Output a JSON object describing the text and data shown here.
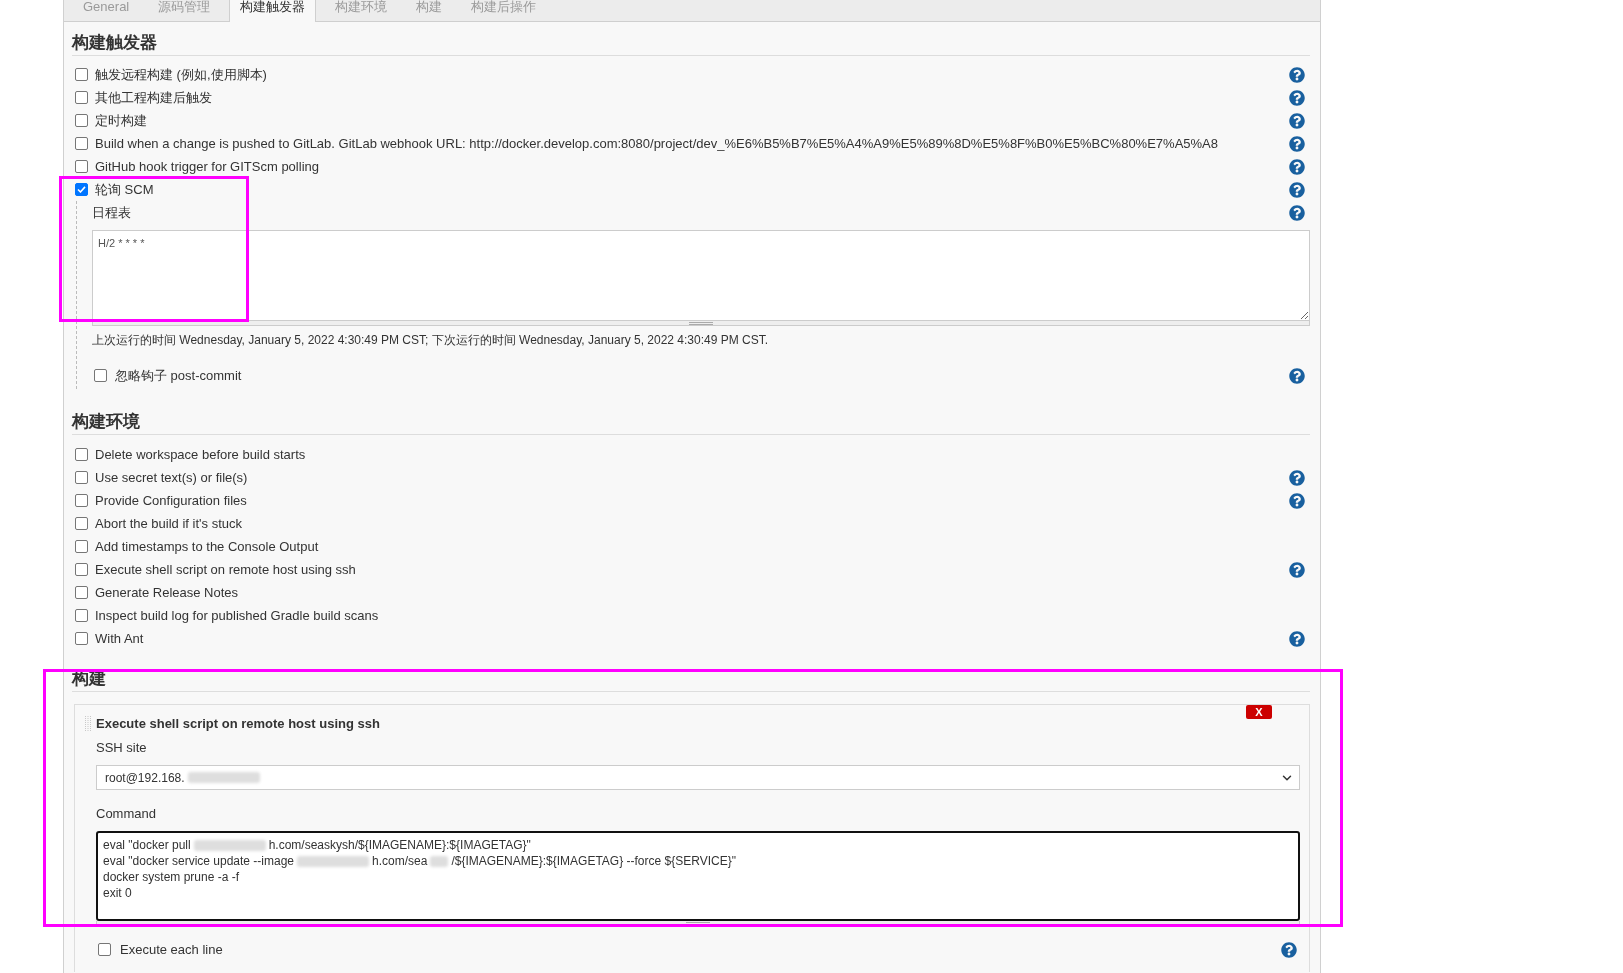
{
  "tabs": [
    {
      "label": "General",
      "selected": false
    },
    {
      "label": "源码管理",
      "selected": false
    },
    {
      "label": "构建触发器",
      "selected": true
    },
    {
      "label": "构建环境",
      "selected": false
    },
    {
      "label": "构建",
      "selected": false
    },
    {
      "label": "构建后操作",
      "selected": false
    }
  ],
  "sections": [
    {
      "kind": "triggers",
      "title": "构建触发器",
      "highlighted": false,
      "items": [
        {
          "label": "触发远程构建 (例如,使用脚本)",
          "checked": false,
          "help": true,
          "highlighted": false
        },
        {
          "label": "其他工程构建后触发",
          "checked": false,
          "help": true,
          "highlighted": false
        },
        {
          "label": "定时构建",
          "checked": false,
          "help": true,
          "highlighted": false
        },
        {
          "label": "Build when a change is pushed to GitLab. GitLab webhook URL: http://docker.develop.com:8080/project/dev_%E6%B5%B7%E5%A4%A9%E5%89%8D%E5%8F%B0%E5%BC%80%E7%A5%A8",
          "checked": false,
          "help": true,
          "highlighted": false
        },
        {
          "label": "GitHub hook trigger for GITScm polling",
          "checked": false,
          "help": true,
          "highlighted": false
        },
        {
          "label": "轮询 SCM",
          "checked": true,
          "help": true,
          "highlighted": true,
          "schedule": {
            "label": "日程表",
            "help": true,
            "value": "H/2 * * * *",
            "run_info": "上次运行的时间 Wednesday, January 5, 2022 4:30:49 PM CST; 下次运行的时间 Wednesday, January 5, 2022 4:30:49 PM CST.",
            "options": [
              {
                "label": "忽略钩子 post-commit",
                "checked": false,
                "help": true
              }
            ]
          }
        }
      ]
    },
    {
      "kind": "environment",
      "title": "构建环境",
      "highlighted": false,
      "items": [
        {
          "label": "Delete workspace before build starts",
          "checked": false,
          "help": false
        },
        {
          "label": "Use secret text(s) or file(s)",
          "checked": false,
          "help": true
        },
        {
          "label": "Provide Configuration files",
          "checked": false,
          "help": true
        },
        {
          "label": "Abort the build if it's stuck",
          "checked": false,
          "help": false
        },
        {
          "label": "Add timestamps to the Console Output",
          "checked": false,
          "help": false
        },
        {
          "label": "Execute shell script on remote host using ssh",
          "checked": false,
          "help": true
        },
        {
          "label": "Generate Release Notes",
          "checked": false,
          "help": false
        },
        {
          "label": "Inspect build log for published Gradle build scans",
          "checked": false,
          "help": false
        },
        {
          "label": "With Ant",
          "checked": false,
          "help": true
        }
      ]
    },
    {
      "kind": "build",
      "title": "构建",
      "highlighted": true,
      "steps": [
        {
          "title": "Execute shell script on remote host using ssh",
          "delete_label": "X",
          "ssh_site": {
            "label": "SSH site",
            "value": [
              {
                "kind": "text",
                "text": "root@192.168."
              },
              {
                "kind": "redacted",
                "wide": true
              }
            ]
          },
          "command": {
            "label": "Command",
            "lines": [
              [
                {
                  "kind": "text",
                  "text": "eval \"docker pull"
                },
                {
                  "kind": "redacted",
                  "wide": true
                },
                {
                  "kind": "text",
                  "text": "h.com/seaskysh/${IMAGENAME}:${IMAGETAG}\""
                }
              ],
              [
                {
                  "kind": "text",
                  "text": "eval \"docker service update --image"
                },
                {
                  "kind": "redacted",
                  "wide": true
                },
                {
                  "kind": "text",
                  "text": "h.com/sea"
                },
                {
                  "kind": "redacted",
                  "wide": false
                },
                {
                  "kind": "text",
                  "text": "/${IMAGENAME}:${IMAGETAG} --force ${SERVICE}\""
                }
              ],
              [
                {
                  "kind": "text",
                  "text": "docker system prune -a -f"
                }
              ],
              [
                {
                  "kind": "text",
                  "text": "exit 0"
                }
              ]
            ]
          },
          "options": [
            {
              "label": "Execute each line",
              "checked": false,
              "help": true
            }
          ]
        }
      ]
    }
  ]
}
